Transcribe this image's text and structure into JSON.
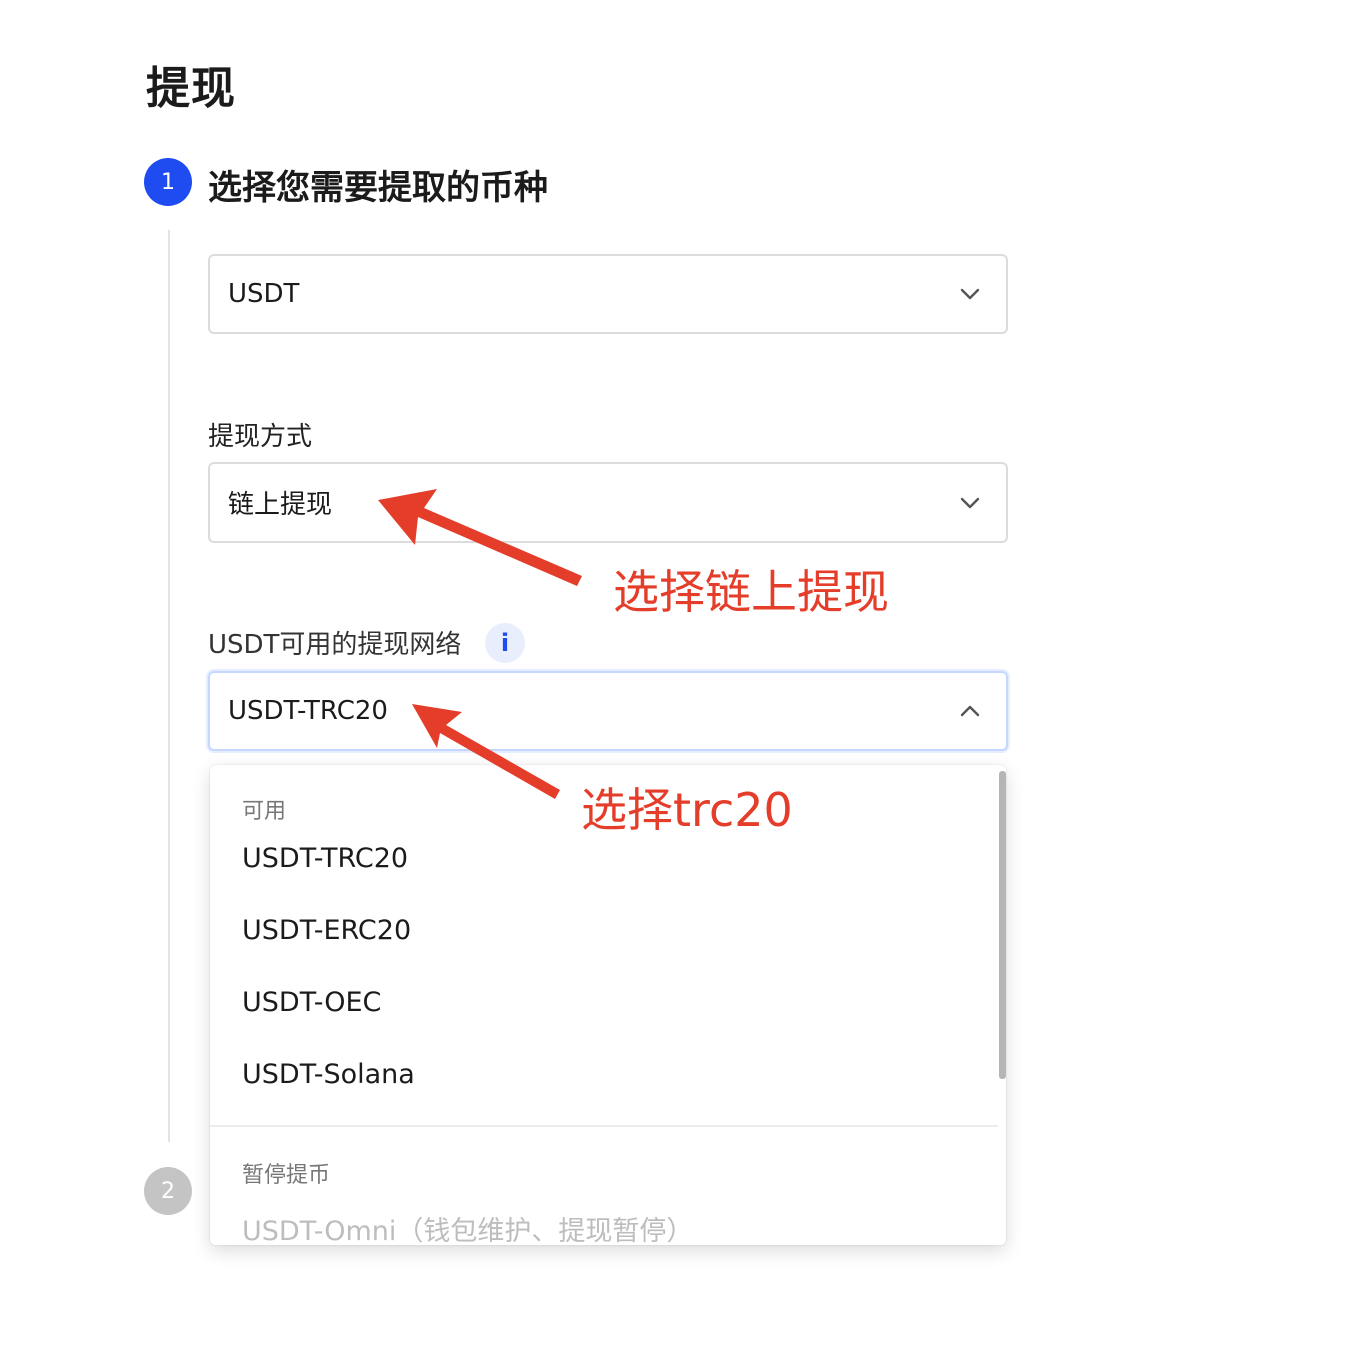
{
  "page_title": "提现",
  "step1": {
    "number": "1",
    "title": "选择您需要提取的币种"
  },
  "step2": {
    "number": "2"
  },
  "coin_select": {
    "value": "USDT"
  },
  "method": {
    "label": "提现方式",
    "value": "链上提现"
  },
  "network": {
    "label": "USDT可用的提现网络",
    "info_icon": "i",
    "value": "USDT-TRC20"
  },
  "dropdown": {
    "available_group": "可用",
    "available_items": [
      "USDT-TRC20",
      "USDT-ERC20",
      "USDT-OEC",
      "USDT-Solana"
    ],
    "paused_group": "暂停提币",
    "paused_items": [
      "USDT-Omni（钱包维护、提现暂停）"
    ]
  },
  "annotations": {
    "method_hint": "选择链上提现",
    "network_hint": "选择trc20"
  },
  "colors": {
    "accent": "#1e4cf0",
    "annotation": "#e43d2a",
    "inactive_step": "#c4c4c4"
  }
}
